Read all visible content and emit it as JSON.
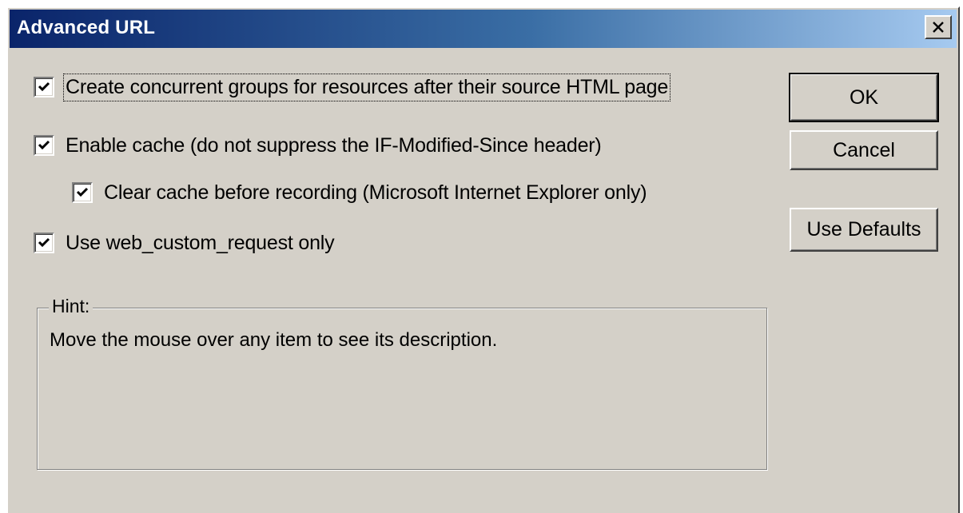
{
  "window": {
    "title": "Advanced URL",
    "close_icon": "close-icon",
    "accent_colors": [
      "#0a246a",
      "#a6caf0"
    ],
    "face_color": "#d4d0c8"
  },
  "options": [
    {
      "id": "concurrent-groups",
      "label": "Create concurrent groups for resources after their source HTML page",
      "checked": true
    },
    {
      "id": "enable-cache",
      "label": "Enable cache (do not suppress the IF-Modified-Since header)",
      "checked": true
    },
    {
      "id": "clear-cache",
      "label": "Clear cache before recording (Microsoft Internet Explorer only)",
      "checked": true
    },
    {
      "id": "web-custom-request",
      "label": "Use web_custom_request only",
      "checked": true
    }
  ],
  "buttons": {
    "ok": "OK",
    "cancel": "Cancel",
    "use_defaults": "Use Defaults"
  },
  "hint": {
    "legend": "Hint:",
    "text": "Move the mouse over any item to see its description."
  }
}
